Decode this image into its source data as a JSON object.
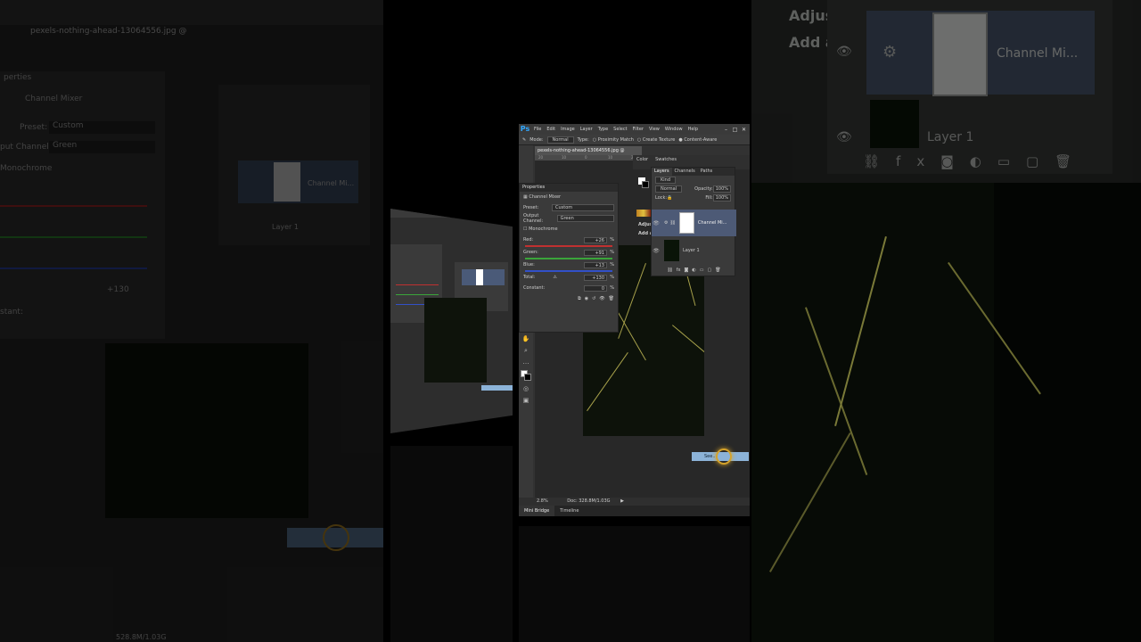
{
  "app": {
    "logo": "Ps",
    "menu": [
      "File",
      "Edit",
      "Image",
      "Layer",
      "Type",
      "Select",
      "Filter",
      "View",
      "Window",
      "Help"
    ],
    "window_buttons": [
      "–",
      "□",
      "✕"
    ]
  },
  "options_bar": {
    "mode_label": "Mode:",
    "mode_value": "Normal",
    "type_label": "Type:",
    "type_options": [
      "Proximity Match",
      "Create Texture",
      "Content-Aware"
    ]
  },
  "document": {
    "tab_title": "pexels-nothing-ahead-13064556.jpg @",
    "ruler_ticks": [
      "20",
      "10",
      "0",
      "10",
      "20"
    ],
    "status_zoom": "2.8%",
    "status_doc": "Doc: 328.8M/1.03G"
  },
  "properties_panel": {
    "title": "Properties",
    "adjustment_name": "Channel Mixer",
    "preset_label": "Preset:",
    "preset_value": "Custom",
    "output_channel_label": "Output Channel:",
    "output_channel_value": "Green",
    "monochrome_label": "Monochrome",
    "red_label": "Red:",
    "red_value": "+26",
    "green_label": "Green:",
    "green_value": "+91",
    "blue_label": "Blue:",
    "blue_value": "+13",
    "total_label": "Total:",
    "total_value": "+130",
    "constant_label": "Constant:",
    "constant_value": "0",
    "percent": "%",
    "colors": {
      "red": "#c03030",
      "green": "#3aa53a",
      "blue": "#3250c8"
    }
  },
  "color_panel": {
    "tabs": [
      "Color",
      "Swatches"
    ]
  },
  "adjustments_panel": {
    "title": "Adjus",
    "add_label": "Add a"
  },
  "layers_panel": {
    "tabs": [
      "Layers",
      "Channels",
      "Paths"
    ],
    "kind_label": "Kind",
    "blend_value": "Normal",
    "opacity_label": "Opacity:",
    "opacity_value": "100%",
    "lock_label": "Lock:",
    "fill_label": "Fill:",
    "fill_value": "100%",
    "layers": [
      {
        "name": "Channel Mi...",
        "selected": true
      },
      {
        "name": "Layer 1",
        "selected": false
      }
    ]
  },
  "bottom_tabs": [
    "Mini Bridge",
    "Timeline"
  ],
  "tooltip": {
    "label": "See..."
  },
  "zoom_overlay": {
    "adjus_text": "Adjus",
    "add_text": "Add a",
    "layer1_name": "Channel Mi...",
    "layer2_name": "Layer 1"
  },
  "left_zoom": {
    "properties_title": "perties",
    "adj_name": "Channel Mixer",
    "preset_label": "Preset:",
    "preset_value": "Custom",
    "output_label": "put Channel:",
    "output_value": "Green",
    "mono": "Monochrome",
    "doc_tab": "pexels-nothing-ahead-13064556.jpg @",
    "layer_name": "Channel Mi...",
    "layer2": "Layer 1",
    "total_value": "+130",
    "constant_label": "stant:",
    "status_doc": "528.8M/1.03G"
  }
}
